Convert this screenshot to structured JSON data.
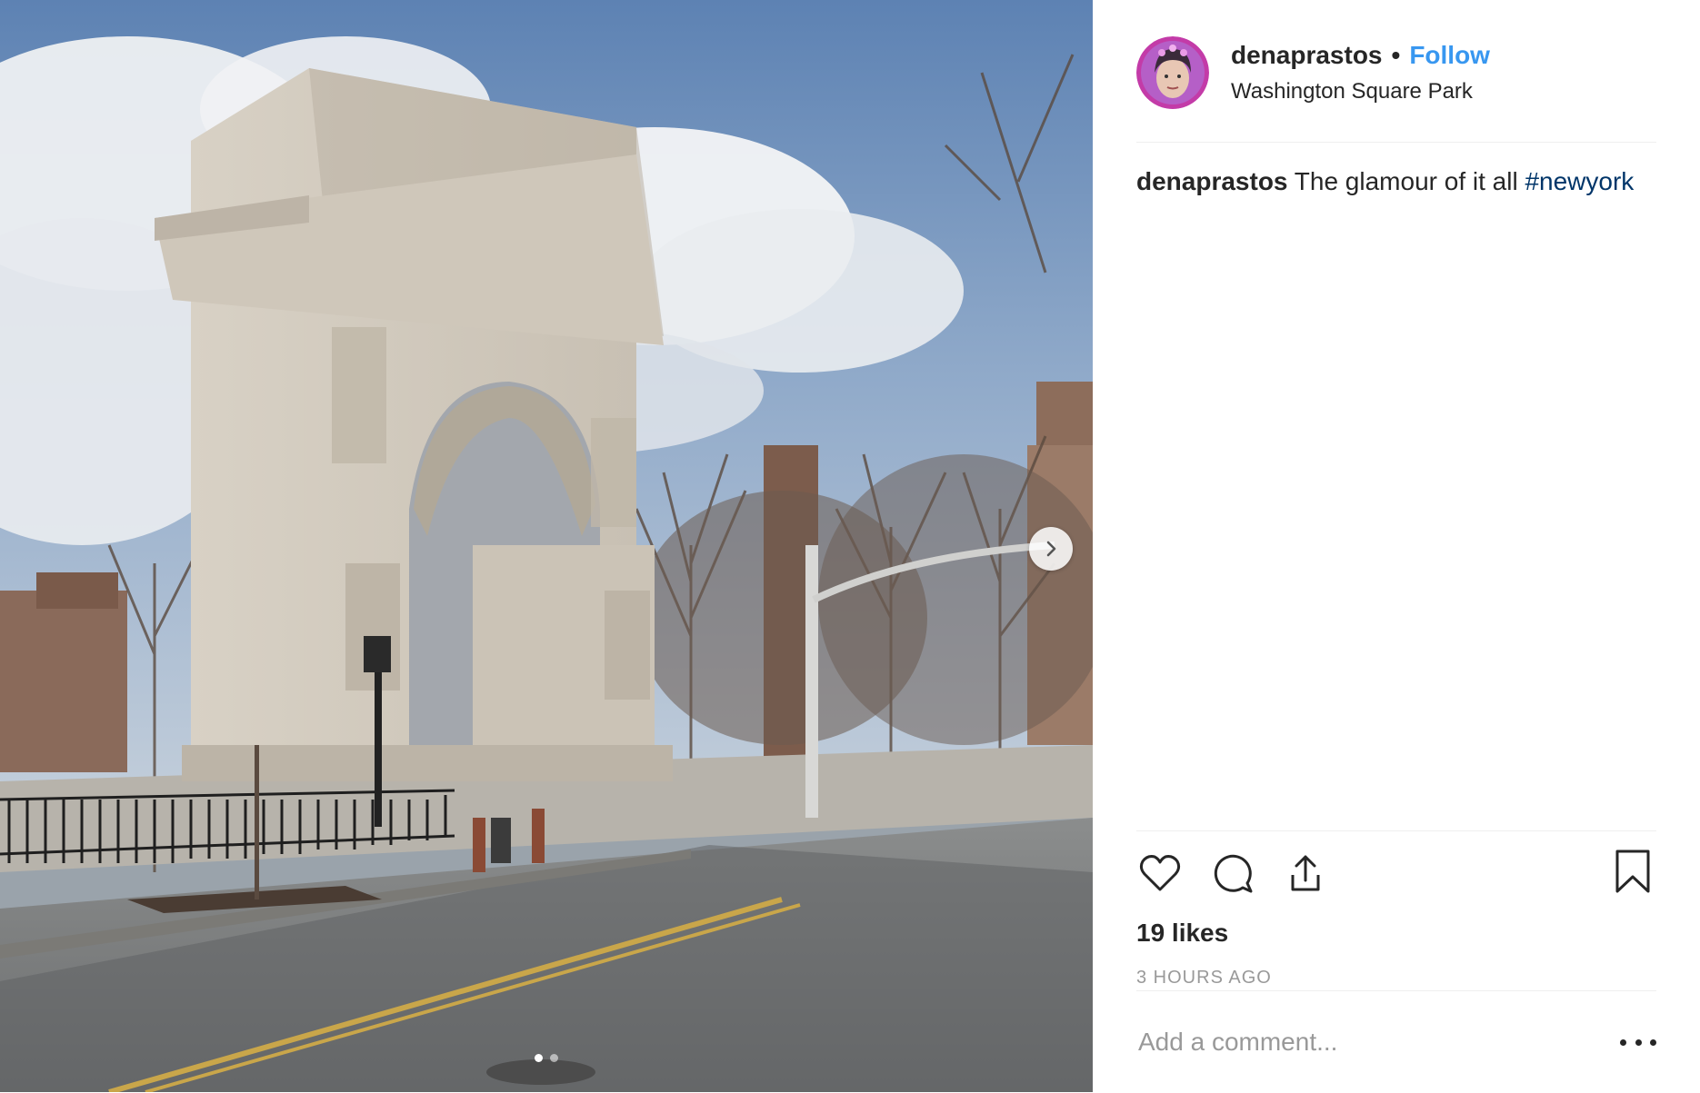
{
  "post": {
    "author": {
      "username": "denaprastos",
      "separator": "•",
      "follow_label": "Follow",
      "location": "Washington Square Park",
      "avatar_icon": "profile-avatar"
    },
    "caption": {
      "username": "denaprastos",
      "text": "The glamour of it all",
      "hashtag": "#newyork"
    },
    "media": {
      "carousel_total": 2,
      "carousel_active": 1,
      "next_icon": "chevron-right-icon"
    },
    "actions": {
      "like_icon": "heart-icon",
      "comment_icon": "comment-icon",
      "share_icon": "share-icon",
      "save_icon": "bookmark-icon"
    },
    "likes_text": "19 likes",
    "timestamp": "3 HOURS AGO",
    "comment_placeholder": "Add a comment...",
    "more_icon": "more-options-icon",
    "colors": {
      "link_blue": "#3897f0",
      "hashtag_blue": "#003569",
      "muted_gray": "#999999"
    }
  }
}
